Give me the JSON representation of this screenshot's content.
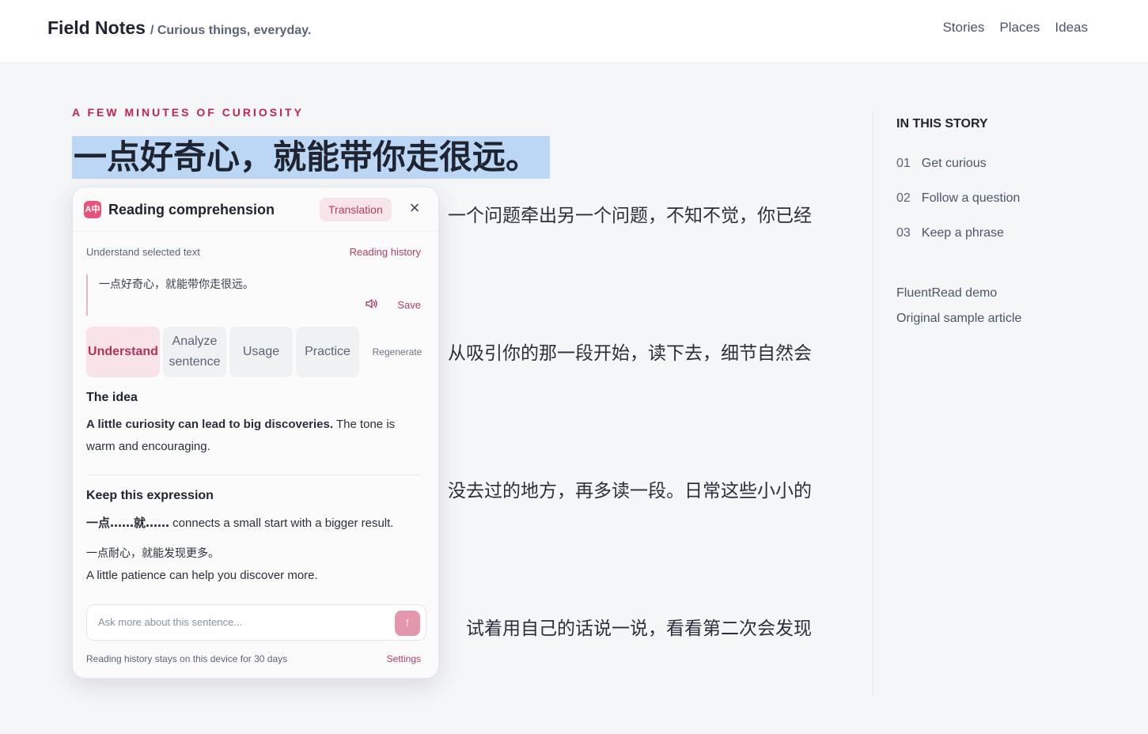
{
  "site": {
    "name": "Field Notes",
    "tagline": "/ Curious things, everyday.",
    "nav": [
      "Stories",
      "Places",
      "Ideas"
    ]
  },
  "article": {
    "kicker": "A FEW MINUTES OF CURIOSITY",
    "headline": "一点好奇心，就能带你走很远。",
    "paragraph_fragments": [
      "一个问题牵出另一个问题，不知不觉，你已经",
      "从吸引你的那一段开始，读下去，细节自然会",
      "没去过的地方，再多读一段。日常这些小小的",
      "试着用自己的话说一说，看看第二次会发现"
    ]
  },
  "sidebar": {
    "title": "IN THIS STORY",
    "toc": [
      {
        "num": "01",
        "label": "Get curious"
      },
      {
        "num": "02",
        "label": "Follow a question"
      },
      {
        "num": "03",
        "label": "Keep a phrase"
      }
    ],
    "links": [
      "FluentRead demo",
      "Original sample article"
    ]
  },
  "panel": {
    "icon_text": "A中",
    "title": "Reading comprehension",
    "mode_pill": "Translation",
    "close_icon": "×",
    "understand_label": "Understand selected text",
    "history_link": "Reading history",
    "selected_text": "一点好奇心，就能带你走很远。",
    "speaker_icon": "speaker-icon",
    "save_label": "Save",
    "tabs": {
      "understand": "Understand",
      "analyze_line1": "Analyze",
      "analyze_line2": "sentence",
      "usage": "Usage",
      "practice": "Practice",
      "regenerate": "Regenerate"
    },
    "idea_title": "The idea",
    "idea_bold": "A little curiosity can lead to big discoveries.",
    "idea_rest": " The tone is warm and encouraging.",
    "expression_title": "Keep this expression",
    "pattern_bold": "一点……就……",
    "pattern_rest": " connects a small start with a bigger result.",
    "example_cn": "一点耐心，就能发现更多。",
    "example_en": "A little patience can help you discover more.",
    "ask_placeholder": "Ask more about this sentence...",
    "send_icon": "↑",
    "footer_note": "Reading history stays on this device for 30 days",
    "settings_label": "Settings"
  },
  "colors": {
    "accent": "#c4244f",
    "highlight": "#bcd7f5",
    "send_button": "#e496ac"
  }
}
